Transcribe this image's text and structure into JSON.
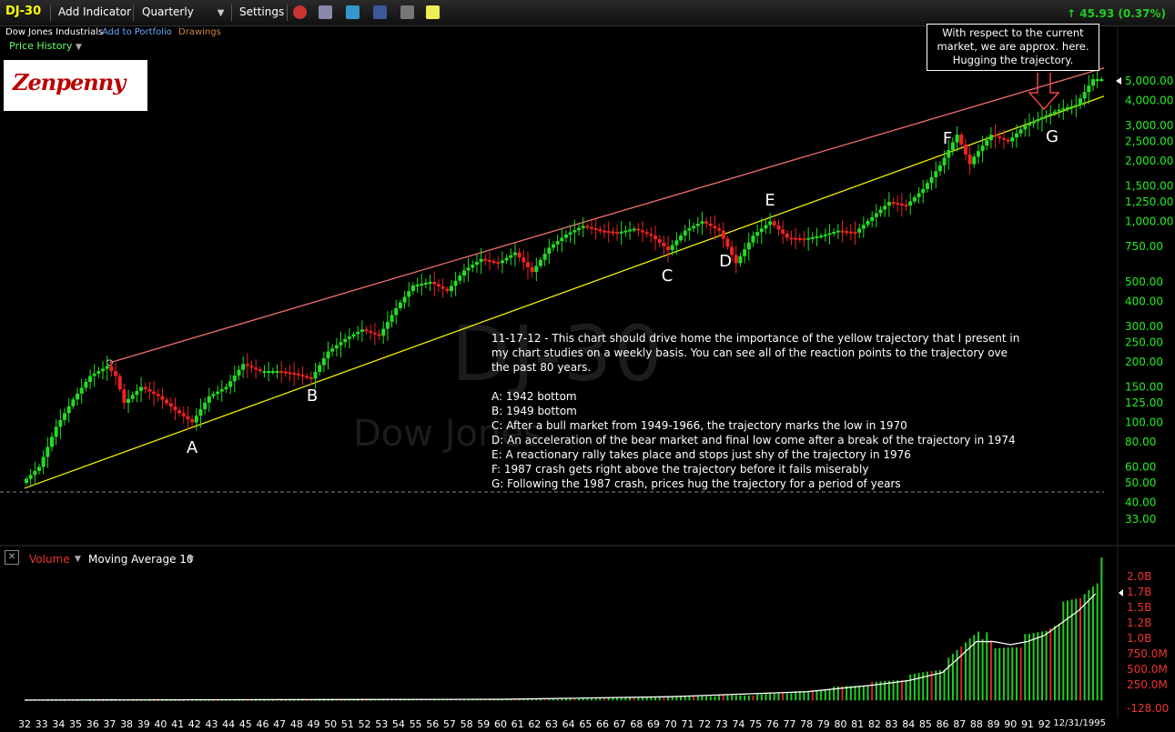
{
  "toolbar": {
    "ticker": "DJ-30",
    "add_indicator": "Add Indicator",
    "period": "Quarterly",
    "settings": "Settings",
    "change": "45.93 (0.37%)"
  },
  "subheader": {
    "name": "Dow Jones Industrials",
    "add_portfolio": "Add to Portfolio",
    "drawings": "Drawings",
    "price_history": "Price History"
  },
  "logo_text": "Zenpenny",
  "watermark": {
    "symbol": "DJ-30",
    "name": "Dow Jones"
  },
  "callout": "With respect to the current market, we are approx. here. Hugging the trajectory.",
  "notes": {
    "intro": "11-17-12 - This chart should drive home the importance of the yellow trajectory that I present in my chart studies on a weekly basis. You can see all of the reaction points to the trajectory ove the past 80 years.",
    "items": [
      "A: 1942 bottom",
      "B: 1949 bottom",
      "C: After a bull market from 1949-1966, the trajectory marks the low in 1970",
      "D: An acceleration of the bear market and final low come after a break of the trajectory in 1974",
      "E: A reactionary rally takes place and stops just shy of the trajectory in 1976",
      "F: 1987 crash gets right above the trajectory before it fails miserably",
      "G: Following the 1987 crash, prices hug the trajectory for a period of years"
    ]
  },
  "volume_panel": {
    "label": "Volume",
    "indicator": "Moving Average 10"
  },
  "colors": {
    "up": "#22dd22",
    "down": "#ee2222",
    "trajectory": "#f0f000",
    "resistance": "#f07070",
    "volume": "#22cc22",
    "volume_down": "#dd2222",
    "ma": "#ffffff"
  },
  "chart_data": {
    "type": "line",
    "scale": "log",
    "price_axis_labels": [
      "5,000.00",
      "4,000.00",
      "3,000.00",
      "2,500.00",
      "2,000.00",
      "1,500.00",
      "1,250.00",
      "1,000.00",
      "750.00",
      "500.00",
      "400.00",
      "300.00",
      "250.00",
      "200.00",
      "150.00",
      "125.00",
      "100.00",
      "80.00",
      "60.00",
      "50.00",
      "40.00",
      "33.00"
    ],
    "price_axis_values": [
      5000,
      4000,
      3000,
      2500,
      2000,
      1500,
      1250,
      1000,
      750,
      500,
      400,
      300,
      250,
      200,
      150,
      125,
      100,
      80,
      60,
      50,
      40,
      33
    ],
    "volume_axis_labels": [
      "2.0B",
      "1.7B",
      "1.5B",
      "1.2B",
      "1.0B",
      "750.0M",
      "500.0M",
      "250.0M",
      "-128.00"
    ],
    "volume_axis_values": [
      2000,
      1750,
      1500,
      1250,
      1000,
      750,
      500,
      250,
      -128
    ],
    "x_labels": [
      "32",
      "33",
      "34",
      "35",
      "36",
      "37",
      "38",
      "39",
      "40",
      "41",
      "42",
      "43",
      "44",
      "45",
      "46",
      "47",
      "48",
      "49",
      "50",
      "51",
      "52",
      "53",
      "54",
      "55",
      "56",
      "57",
      "58",
      "59",
      "60",
      "61",
      "62",
      "63",
      "64",
      "65",
      "66",
      "67",
      "68",
      "69",
      "70",
      "71",
      "72",
      "73",
      "74",
      "75",
      "76",
      "77",
      "78",
      "79",
      "80",
      "81",
      "82",
      "83",
      "84",
      "85",
      "86",
      "87",
      "88",
      "89",
      "90",
      "91",
      "92"
    ],
    "last_date": "12/31/1995",
    "series": [
      {
        "x": [
          1932,
          1933,
          1934,
          1935,
          1936,
          1937,
          1937.5,
          1938,
          1939,
          1940,
          1941,
          1942,
          1943,
          1944,
          1945,
          1946,
          1947,
          1948,
          1949,
          1950,
          1951,
          1952,
          1953,
          1954,
          1955,
          1956,
          1957,
          1958,
          1959,
          1960,
          1961,
          1962,
          1963,
          1964,
          1965,
          1966,
          1967,
          1968,
          1969,
          1970,
          1971,
          1972,
          1973,
          1974,
          1975,
          1976,
          1977,
          1978,
          1979,
          1980,
          1981,
          1982,
          1983,
          1984,
          1985,
          1986,
          1987,
          1987.9,
          1988,
          1989,
          1990,
          1991,
          1992,
          1993,
          1994,
          1995
        ],
        "y": [
          50,
          60,
          95,
          130,
          170,
          190,
          170,
          125,
          150,
          135,
          115,
          100,
          135,
          150,
          195,
          180,
          180,
          175,
          165,
          225,
          260,
          290,
          270,
          370,
          480,
          500,
          450,
          570,
          650,
          620,
          700,
          560,
          740,
          860,
          950,
          900,
          880,
          920,
          850,
          720,
          900,
          1000,
          900,
          620,
          850,
          1000,
          830,
          820,
          850,
          900,
          880,
          1050,
          1250,
          1200,
          1450,
          1900,
          2700,
          1800,
          2100,
          2700,
          2500,
          3000,
          3300,
          3600,
          3800,
          5100
        ]
      }
    ],
    "trajectory_yellow": {
      "x": [
        1932,
        1995.5
      ],
      "y": [
        47,
        4200
      ]
    },
    "resistance_red": {
      "x": [
        1937,
        1995.5
      ],
      "y": [
        198,
        5800
      ]
    },
    "reaction_points": [
      {
        "label": "A",
        "year": 1942
      },
      {
        "label": "B",
        "year": 1949
      },
      {
        "label": "C",
        "year": 1970
      },
      {
        "label": "D",
        "year": 1974
      },
      {
        "label": "E",
        "year": 1976
      },
      {
        "label": "F",
        "year": 1987
      },
      {
        "label": "G",
        "year": 1992
      }
    ],
    "volume_series": {
      "name": "Volume",
      "x": [
        1932,
        1940,
        1950,
        1960,
        1965,
        1970,
        1975,
        1978,
        1980,
        1982,
        1984,
        1986,
        1987,
        1988,
        1989,
        1990,
        1991,
        1992,
        1993,
        1994,
        1995
      ],
      "y": [
        6,
        6,
        8,
        20,
        30,
        60,
        90,
        150,
        220,
        280,
        380,
        550,
        850,
        1200,
        800,
        900,
        1000,
        1150,
        1450,
        1650,
        2100
      ]
    },
    "ma_series": {
      "name": "Moving Average 10",
      "x": [
        1932,
        1960,
        1970,
        1978,
        1982,
        1984,
        1986,
        1987,
        1988,
        1989,
        1990,
        1991,
        1992,
        1993,
        1994,
        1995
      ],
      "y": [
        6,
        18,
        60,
        140,
        250,
        320,
        450,
        700,
        950,
        950,
        900,
        950,
        1050,
        1250,
        1450,
        1720
      ]
    }
  }
}
